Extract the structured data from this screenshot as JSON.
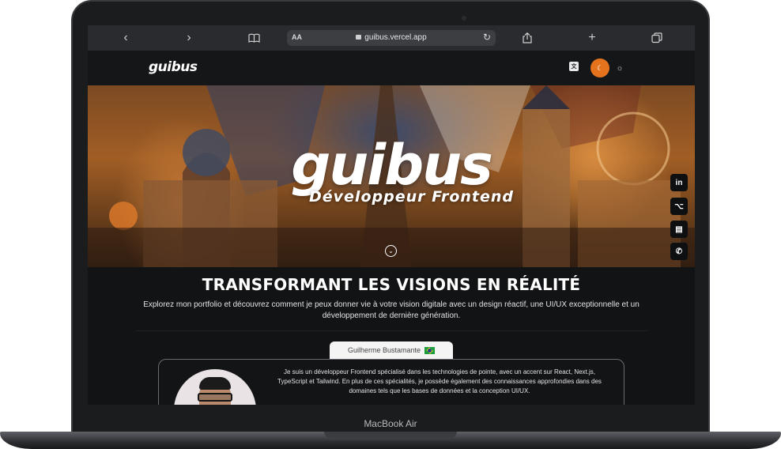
{
  "browser": {
    "url": "guibus.vercel.app",
    "reader_label": "AA",
    "icons": {
      "back": "chevron-left-icon",
      "forward": "chevron-right-icon",
      "bookmarks": "book-icon",
      "reload": "reload-icon",
      "share": "share-icon",
      "new_tab": "plus-icon",
      "tabs": "tabs-icon"
    }
  },
  "site": {
    "logo": "guibus",
    "accent_color": "#e5731d"
  },
  "hero": {
    "title": "guibus",
    "subtitle": "Développeur Frontend"
  },
  "social": {
    "items": [
      "in",
      "⌥",
      "▤",
      "✆"
    ]
  },
  "content": {
    "headline": "TRANSFORMANT LES VISIONS EN RÉALITÉ",
    "lead": "Explorez mon portfolio et découvrez comment je peux donner vie à votre vision digitale avec un design réactif, une UI/UX exceptionnelle et un développement de dernière génération.",
    "name_tab": "Guilherme Bustamante",
    "bio": "Je suis un développeur Frontend spécialisé dans les technologies de pointe, avec un accent sur React, Next.js, TypeScript et Tailwind. En plus de ces spécialités, je possède également des connaissances approfondies dans des domaines tels que les bases de données et la conception UI/UX."
  },
  "device": {
    "model": "MacBook Air"
  }
}
